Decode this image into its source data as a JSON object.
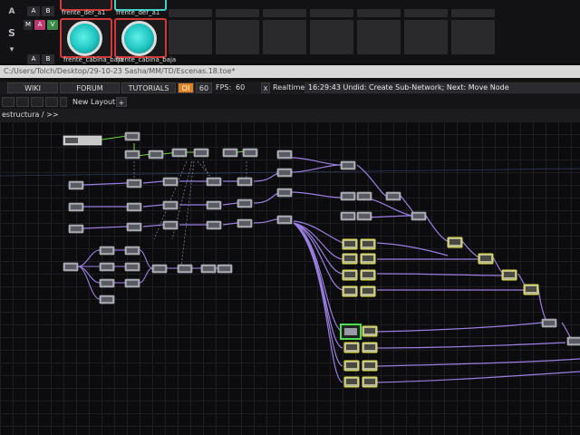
{
  "panel": {
    "row_letter_a": "A",
    "row_letter_s": "S",
    "row_letter_caret": "▾",
    "col_a": "A",
    "col_b": "B",
    "mute": "M",
    "activate": "A",
    "view": "V",
    "tiles": [
      {
        "label_top": "frente_der_a1",
        "label_bottom": "frente_cabina_baja"
      },
      {
        "label_top": "frente_der_a1",
        "label_bottom": "frente_cabina_baja"
      }
    ]
  },
  "path": {
    "text": "C:/Users/Tolch/Desktop/29-10-23 Sasha/MM/TD/Escenas.18.toe*"
  },
  "toolbar": {
    "wiki": "WIKI",
    "forum": "FORUM",
    "tutorials": "TUTORIALS",
    "perform": "OI",
    "fps_target": "60",
    "fps_label": "FPS:",
    "fps_value": "60",
    "realtime_check": "X",
    "realtime_label": "Realtime",
    "status": "16:29:43 Undid: Create Sub-Network; Next: Move Node"
  },
  "layout": {
    "new_layout": "New Layout",
    "add_layout": "+"
  },
  "breadcrumb": {
    "path": "estructura / >>"
  },
  "colors": {
    "wire": "#9a7fe0",
    "wire_green": "#6ed63c",
    "selected_border": "#4be04b",
    "top_border": "#d6d641",
    "dat_border": "#e6e63c"
  }
}
